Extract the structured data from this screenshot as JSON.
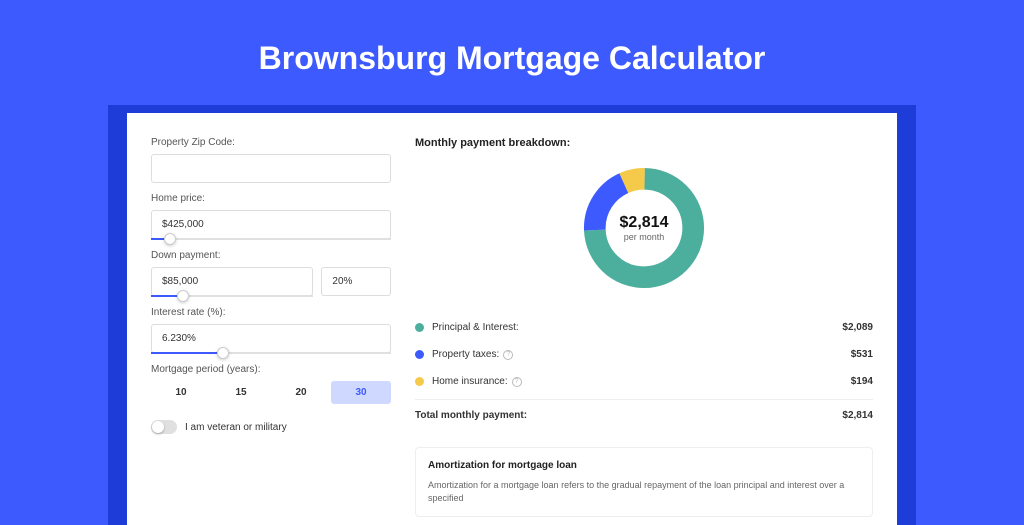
{
  "title": "Brownsburg Mortgage Calculator",
  "form": {
    "zip_label": "Property Zip Code:",
    "zip_value": "",
    "price_label": "Home price:",
    "price_value": "$425,000",
    "price_slider_pct": 8,
    "down_label": "Down payment:",
    "down_value": "$85,000",
    "down_pct_value": "20%",
    "down_slider_pct": 20,
    "rate_label": "Interest rate (%):",
    "rate_value": "6.230%",
    "rate_slider_pct": 30,
    "period_label": "Mortgage period (years):",
    "periods": [
      "10",
      "15",
      "20",
      "30"
    ],
    "period_active_index": 3,
    "veteran_label": "I am veteran or military"
  },
  "breakdown": {
    "heading": "Monthly payment breakdown:",
    "donut_amount": "$2,814",
    "donut_sub": "per month",
    "items": [
      {
        "label": "Principal & Interest:",
        "value": "$2,089",
        "color": "#4caf9d",
        "info": false
      },
      {
        "label": "Property taxes:",
        "value": "$531",
        "color": "#3d5afe",
        "info": true
      },
      {
        "label": "Home insurance:",
        "value": "$194",
        "color": "#f5c94a",
        "info": true
      }
    ],
    "total_label": "Total monthly payment:",
    "total_value": "$2,814"
  },
  "amort": {
    "title": "Amortization for mortgage loan",
    "text": "Amortization for a mortgage loan refers to the gradual repayment of the loan principal and interest over a specified"
  },
  "chart_data": {
    "type": "pie",
    "title": "Monthly payment breakdown",
    "series": [
      {
        "name": "Principal & Interest",
        "value": 2089,
        "color": "#4caf9d"
      },
      {
        "name": "Property taxes",
        "value": 531,
        "color": "#3d5afe"
      },
      {
        "name": "Home insurance",
        "value": 194,
        "color": "#f5c94a"
      }
    ],
    "total": 2814,
    "center_label": "$2,814 per month"
  }
}
